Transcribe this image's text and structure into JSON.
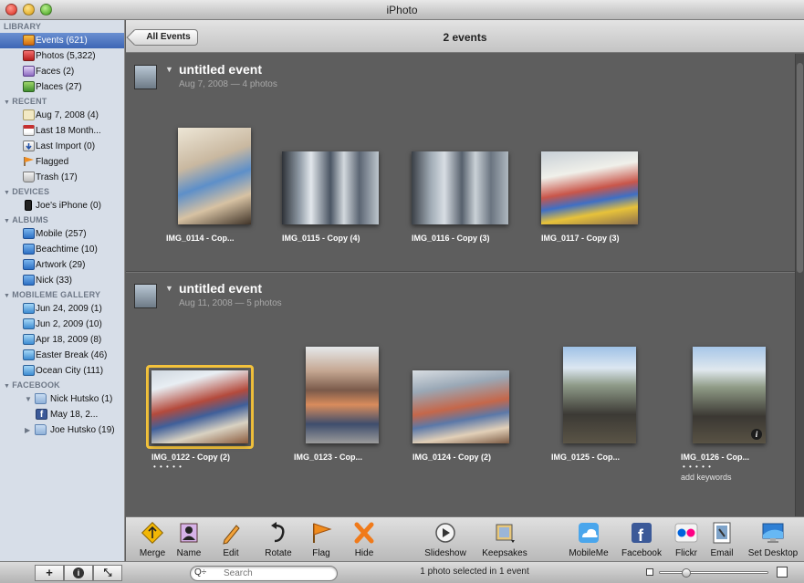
{
  "window": {
    "title": "iPhoto"
  },
  "sidebar": {
    "sections": [
      {
        "heading": "LIBRARY",
        "items": [
          {
            "label": "Events (621)",
            "icon": "events-icon",
            "selected": true
          },
          {
            "label": "Photos (5,322)",
            "icon": "photos-icon"
          },
          {
            "label": "Faces (2)",
            "icon": "faces-icon"
          },
          {
            "label": "Places (27)",
            "icon": "places-icon"
          }
        ]
      },
      {
        "heading": "RECENT",
        "items": [
          {
            "label": "Aug 7, 2008 (4)",
            "icon": "event-icon"
          },
          {
            "label": "Last 18 Month...",
            "icon": "calendar-icon"
          },
          {
            "label": "Last Import (0)",
            "icon": "import-icon"
          },
          {
            "label": "Flagged",
            "icon": "flag-icon"
          },
          {
            "label": "Trash (17)",
            "icon": "trash-icon"
          }
        ]
      },
      {
        "heading": "DEVICES",
        "items": [
          {
            "label": "Joe's iPhone (0)",
            "icon": "iphone-icon"
          }
        ]
      },
      {
        "heading": "ALBUMS",
        "items": [
          {
            "label": "Mobile (257)",
            "icon": "album-icon"
          },
          {
            "label": "Beachtime (10)",
            "icon": "album-icon"
          },
          {
            "label": "Artwork (29)",
            "icon": "album-icon"
          },
          {
            "label": "Nick (33)",
            "icon": "album-icon"
          }
        ]
      },
      {
        "heading": "MOBILEME GALLERY",
        "items": [
          {
            "label": "Jun 24, 2009 (1)",
            "icon": "mobileme-gallery-icon"
          },
          {
            "label": "Jun 2, 2009 (10)",
            "icon": "mobileme-gallery-icon"
          },
          {
            "label": "Apr 18, 2009 (8)",
            "icon": "mobileme-gallery-icon"
          },
          {
            "label": "Easter Break (46)",
            "icon": "mobileme-gallery-icon"
          },
          {
            "label": "Ocean City (111)",
            "icon": "mobileme-gallery-icon"
          }
        ]
      },
      {
        "heading": "FACEBOOK",
        "items": [
          {
            "label": "Nick Hutsko (1)",
            "icon": "folder-icon",
            "expanded": true
          },
          {
            "label": "May 18, 2...",
            "icon": "facebook-album-icon",
            "nested": true
          },
          {
            "label": "Joe Hutsko (19)",
            "icon": "folder-icon",
            "expanded": false
          }
        ]
      }
    ]
  },
  "header": {
    "back_button": "All Events",
    "title": "2 events"
  },
  "events": [
    {
      "title": "untitled event",
      "subtitle": "Aug 7, 2008 — 4 photos",
      "photos": [
        {
          "caption": "IMG_0114 - Cop...",
          "orientation": "portrait"
        },
        {
          "caption": "IMG_0115 - Copy (4)",
          "orientation": "landscape"
        },
        {
          "caption": "IMG_0116 - Copy (3)",
          "orientation": "landscape"
        },
        {
          "caption": "IMG_0117 - Copy (3)",
          "orientation": "landscape"
        }
      ]
    },
    {
      "title": "untitled event",
      "subtitle": "Aug 11, 2008 — 5 photos",
      "photos": [
        {
          "caption": "IMG_0122 - Copy (2)",
          "orientation": "landscape",
          "selected": true,
          "rating_dots": "• • • • •"
        },
        {
          "caption": "IMG_0123 - Cop...",
          "orientation": "portrait"
        },
        {
          "caption": "IMG_0124 - Copy (2)",
          "orientation": "landscape"
        },
        {
          "caption": "IMG_0125 - Cop...",
          "orientation": "portrait"
        },
        {
          "caption": "IMG_0126 - Cop...",
          "orientation": "portrait",
          "rating_dots": "• • • • •",
          "keywords_hint": "add keywords",
          "info": "i"
        }
      ]
    }
  ],
  "toolbar": {
    "buttons": [
      {
        "label": "Merge",
        "icon": "merge-icon"
      },
      {
        "label": "Name",
        "icon": "name-icon"
      },
      {
        "label": "Edit",
        "icon": "edit-icon"
      },
      {
        "label": "Rotate",
        "icon": "rotate-icon"
      },
      {
        "label": "Flag",
        "icon": "flag-icon"
      },
      {
        "label": "Hide",
        "icon": "hide-icon"
      },
      {
        "label": "Slideshow",
        "icon": "slideshow-icon"
      },
      {
        "label": "Keepsakes",
        "icon": "keepsakes-icon"
      },
      {
        "label": "MobileMe",
        "icon": "mobileme-icon"
      },
      {
        "label": "Facebook",
        "icon": "facebook-icon"
      },
      {
        "label": "Flickr",
        "icon": "flickr-icon"
      },
      {
        "label": "Email",
        "icon": "email-icon"
      },
      {
        "label": "Set Desktop",
        "icon": "set-desktop-icon"
      }
    ]
  },
  "bottombar": {
    "add_label": "+",
    "info_label": "i",
    "fullscreen_label": "⤡",
    "search_scope": "Q÷",
    "search_placeholder": "Search",
    "status": "1 photo selected in 1 event",
    "zoom_level": 0.22
  }
}
